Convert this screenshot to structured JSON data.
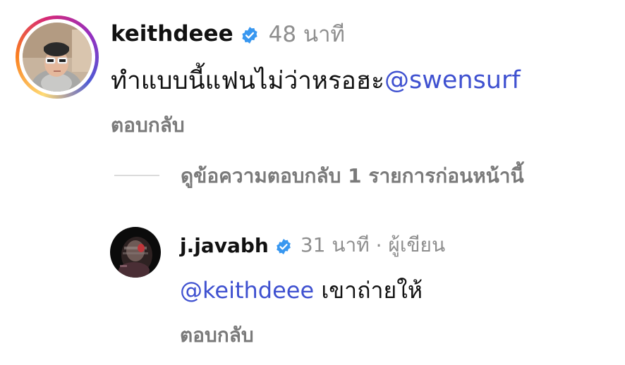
{
  "comment": {
    "username": "keithdeee",
    "time": "48 นาที",
    "text": "ทำแบบนี้แฟนไม่ว่าหรอฮะ ",
    "mention": "@swensurf",
    "reply_label": "ตอบกลับ"
  },
  "view_previous_replies": "ดูข้อความตอบกลับ 1 รายการก่อนหน้านี้",
  "reply": {
    "username": "j.javabh",
    "time": "31 นาที",
    "separator": " · ",
    "author_label": "ผู้เขียน",
    "mention": "@keithdeee",
    "text": " เขาถ่ายให้",
    "reply_label": "ตอบกลับ"
  },
  "colors": {
    "mention": "#3f51d0",
    "verified": "#3897f0",
    "muted": "#7a7a7a"
  }
}
